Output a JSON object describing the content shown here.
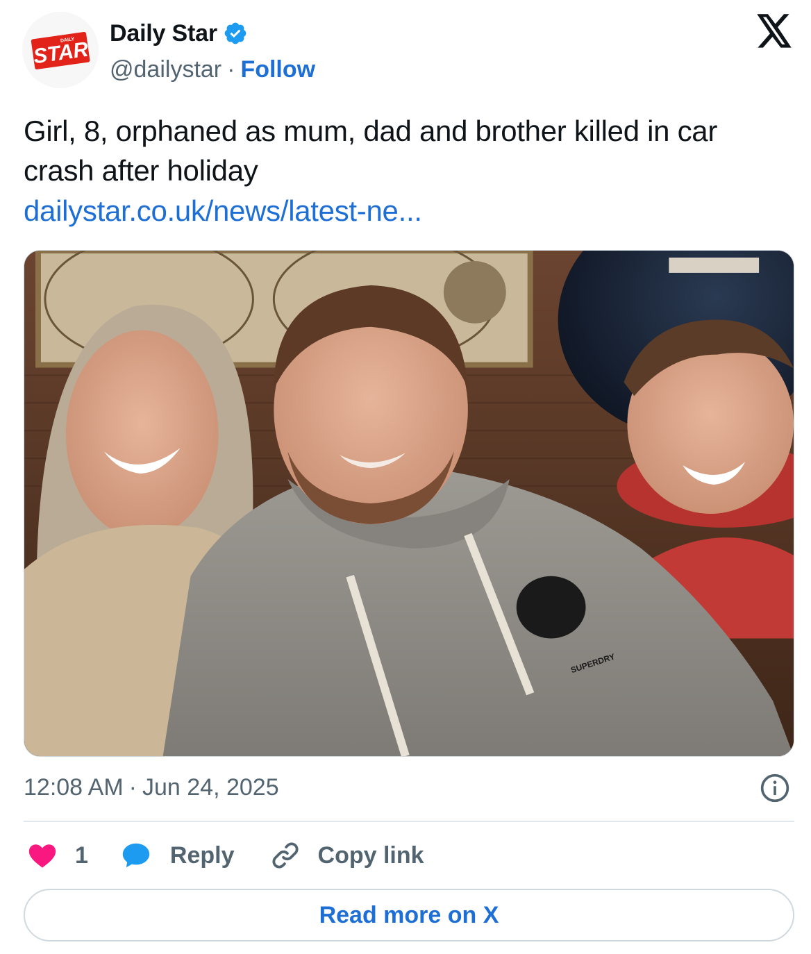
{
  "author": {
    "display_name": "Daily Star",
    "handle": "@dailystar",
    "separator": "·",
    "follow_label": "Follow",
    "avatar_logo_small_text": "DAILY",
    "avatar_logo_text": "STAR",
    "verified": true
  },
  "tweet": {
    "text": "Girl, 8, orphaned as mum, dad and brother killed in car crash after holiday",
    "link_text": "dailystar.co.uk/news/latest-ne...",
    "image_alt": "photo of a smiling woman, man in grey hoodie, and boy",
    "hoodie_print": "SUPERDRY"
  },
  "meta": {
    "time": "12:08 AM",
    "separator": "·",
    "date": "Jun 24, 2025"
  },
  "actions": {
    "like_count": "1",
    "reply_label": "Reply",
    "copy_link_label": "Copy link",
    "read_more_label": "Read more on X"
  },
  "colors": {
    "link_blue": "#1d6fd6",
    "verified_blue": "#1d9bf0",
    "like_pink": "#f91880",
    "brand_red": "#e2231a",
    "secondary_text": "#536471"
  },
  "icons": {
    "platform": "x-logo-icon",
    "verified": "verified-badge-icon",
    "info": "info-icon",
    "like": "heart-icon",
    "reply": "speech-bubble-icon",
    "copy": "link-icon"
  }
}
